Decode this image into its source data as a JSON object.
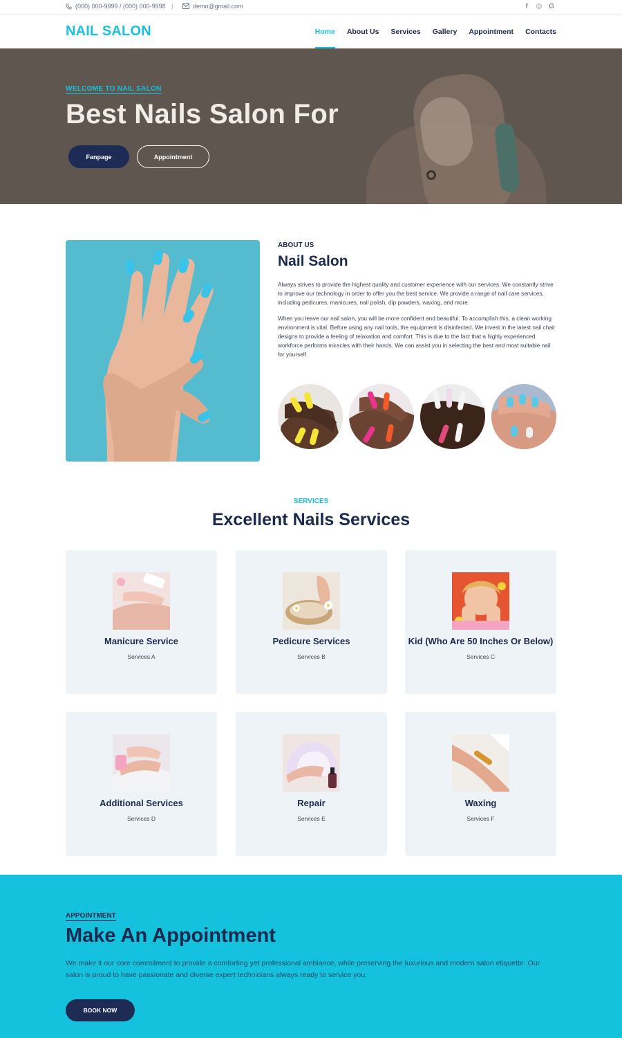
{
  "topbar": {
    "phone": "(000) 000-9999 / (000) 000-9998",
    "separator": "|",
    "email": "demo@gmail.com",
    "social": [
      "f",
      "◎",
      "G"
    ]
  },
  "header": {
    "logo": "NAIL SALON",
    "nav": [
      "Home",
      "About Us",
      "Services",
      "Gallery",
      "Appointment",
      "Contacts"
    ],
    "active": "Home"
  },
  "hero": {
    "tagline": "WELCOME TO NAIL SALON",
    "title": "Best Nails Salon For",
    "fanpage_button": "Fanpage",
    "appointment_button": "Appointment"
  },
  "about": {
    "label": "ABOUT US",
    "title": "Nail Salon",
    "paragraph1": "Always strives to provide the highest quality and customer experience with our services. We constantly strive to improve our technology in order to offer you the best service. We provide a range of nail care services, including pedicures, manicures, nail polish, dip powders, waxing, and more.",
    "paragraph2": "When you leave our nail salon, you will be more confident and beautiful. To accomplish this, a clean working environment is vital. Before using any nail tools, the equipment is disinfected. We invest in the latest nail chair designs to provide a feeling of relaxation and comfort. This is due to the fact that a highly experienced workforce performs miracles with their hands. We can assist you in selecting the best and most suitable nail for yourself."
  },
  "services": {
    "label": "SERVICES",
    "title": "Excellent Nails Services",
    "items": [
      {
        "title": "Manicure Service",
        "subtitle": "Services A"
      },
      {
        "title": "Pedicure Services",
        "subtitle": "Services B"
      },
      {
        "title": "Kid (Who Are 50 Inches Or Below)",
        "subtitle": "Services C"
      },
      {
        "title": "Additional Services",
        "subtitle": "Services D"
      },
      {
        "title": "Repair",
        "subtitle": "Services E"
      },
      {
        "title": "Waxing",
        "subtitle": "Services F"
      }
    ]
  },
  "appointment": {
    "label": "APPOINTMENT",
    "title": "Make An Appointment",
    "description": "We make it our core commitment to provide a comforting yet professional ambiance, while preserving the luxurious and modern salon etiquette. Our salon is proud to have passionate and diverse expert technicians always ready to service you.",
    "button": "BOOK NOW"
  },
  "colors": {
    "accent": "#17c1dc",
    "navy": "#1b2a4e",
    "appointment_bg": "#14c2de",
    "card_bg": "#eef3f8"
  }
}
